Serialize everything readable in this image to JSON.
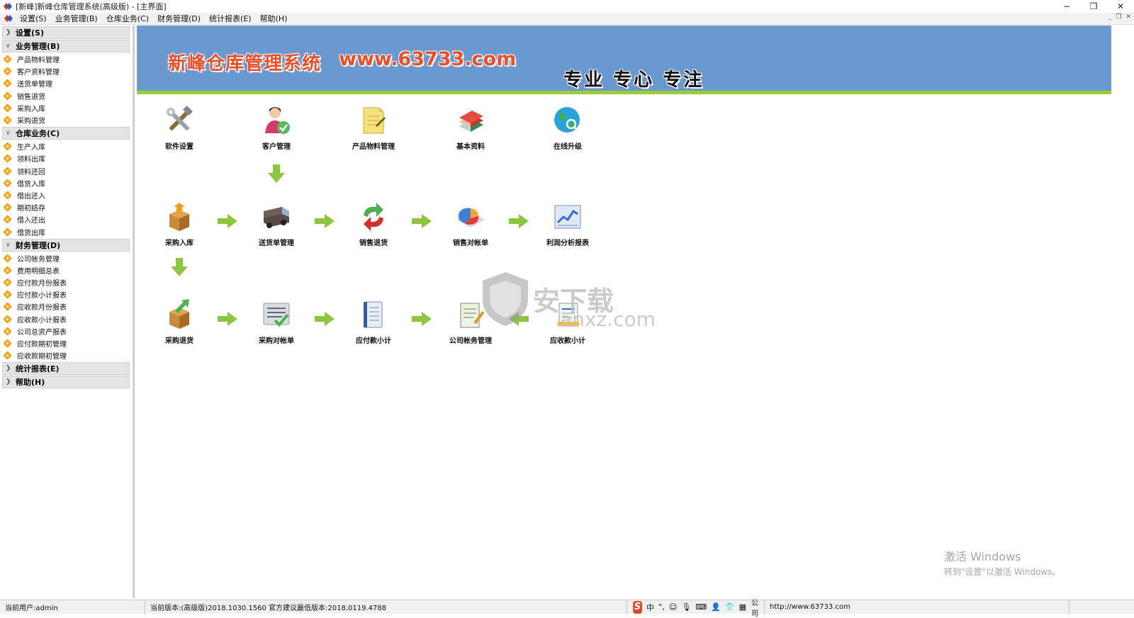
{
  "window": {
    "title": "[新峰]新峰仓库管理系统(高级版) - [主界面]",
    "controls": [
      "−",
      "❐",
      "✕"
    ]
  },
  "menubar": {
    "items": [
      "设置(S)",
      "业务管理(B)",
      "仓库业务(C)",
      "财务管理(D)",
      "统计报表(E)",
      "帮助(H)"
    ],
    "mdi_controls": [
      "_",
      "❐",
      "✕"
    ]
  },
  "sidebar": {
    "groups": [
      {
        "label": "设置(S)",
        "expanded": false,
        "items": []
      },
      {
        "label": "业务管理(B)",
        "expanded": true,
        "items": [
          "产品物料管理",
          "客户资料管理",
          "送货单管理",
          "销售退货",
          "采购入库",
          "采购退货"
        ]
      },
      {
        "label": "仓库业务(C)",
        "expanded": true,
        "items": [
          "生产入库",
          "领料出库",
          "领料还回",
          "借货入库",
          "借出还入",
          "期初结存",
          "借入还出",
          "借货出库"
        ]
      },
      {
        "label": "财务管理(D)",
        "expanded": true,
        "items": [
          "公司帐务管理",
          "费用明细总表",
          "应付款月份报表",
          "应付款小计报表",
          "应收款月份报表",
          "应收款小计报表",
          "公司总资产报表",
          "应付款期初管理",
          "应收款期初管理"
        ]
      },
      {
        "label": "统计报表(E)",
        "expanded": false,
        "items": []
      },
      {
        "label": "帮助(H)",
        "expanded": false,
        "items": []
      }
    ]
  },
  "banner": {
    "brand": "新峰仓库管理系统",
    "url": "www.63733.com",
    "slogan": "专业 专心 专注"
  },
  "tiles": {
    "row1": [
      "软件设置",
      "客户管理",
      "产品物料管理",
      "基本资料",
      "在线升级"
    ],
    "row2": [
      "采购入库",
      "送货单管理",
      "销售退货",
      "销售对帐单",
      "利润分析报表"
    ],
    "row3": [
      "采购退货",
      "采购对帐单",
      "应付款小计",
      "公司帐务管理",
      "应收款小计"
    ]
  },
  "watermark": {
    "text": "安下载",
    "sub": "anxz.com"
  },
  "activation": {
    "line1": "激活 Windows",
    "line2": "转到\"设置\"以激活 Windows。"
  },
  "statusbar": {
    "user": "当前用户:admin",
    "version": "当前版本:(高级版)2018.1030.1560 官方建议最低版本:2018.0119.4788",
    "ime_mode": "中",
    "company": "公司",
    "website": "http://www.63733.com"
  },
  "colors": {
    "banner_bg": "#6b99cf",
    "banner_stripe": "#9acd3a",
    "brand_red": "#e8502c",
    "arrow_green": "#8cc63f",
    "tag_orange": "#f2a81d"
  }
}
